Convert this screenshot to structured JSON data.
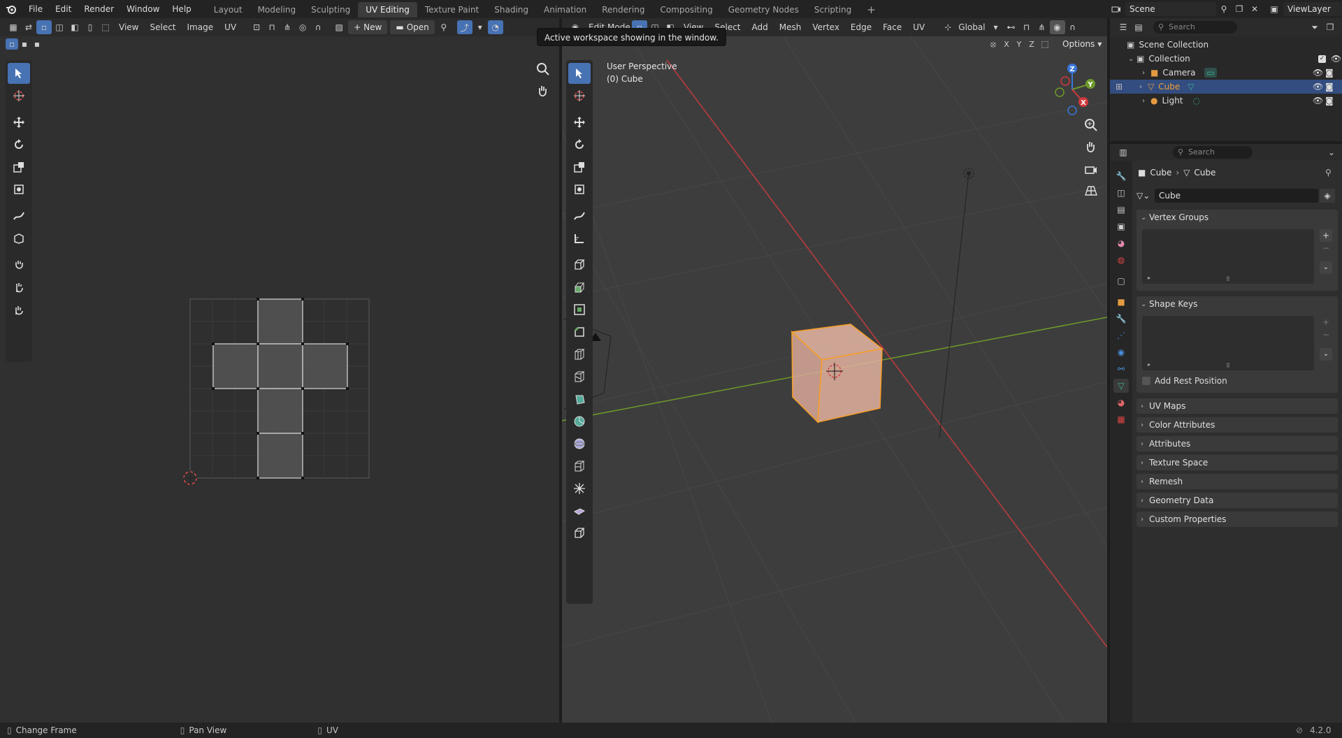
{
  "topbar": {
    "menus": [
      "File",
      "Edit",
      "Render",
      "Window",
      "Help"
    ],
    "workspaces": [
      "Layout",
      "Modeling",
      "Sculpting",
      "UV Editing",
      "Texture Paint",
      "Shading",
      "Animation",
      "Rendering",
      "Compositing",
      "Geometry Nodes",
      "Scripting"
    ],
    "active_workspace": "UV Editing",
    "add_tab": "+",
    "scene": "Scene",
    "view_layer": "ViewLayer"
  },
  "tooltip": "Active workspace showing in the window.",
  "uv_editor": {
    "menus": [
      "View",
      "Select",
      "Image",
      "UV"
    ],
    "new_label": "New",
    "open_label": "Open"
  },
  "viewport": {
    "mode": "Edit Mode",
    "menus": [
      "View",
      "Select",
      "Add",
      "Mesh",
      "Vertex",
      "Edge",
      "Face",
      "UV"
    ],
    "orientation": "Global",
    "options_label": "Options",
    "axis_x": "X",
    "axis_y": "Y",
    "axis_z": "Z",
    "info_line1": "User Perspective",
    "info_line2": "(0) Cube"
  },
  "outliner": {
    "search_placeholder": "Search",
    "scene_collection": "Scene Collection",
    "collection": "Collection",
    "items": [
      {
        "name": "Camera"
      },
      {
        "name": "Cube"
      },
      {
        "name": "Light"
      }
    ]
  },
  "properties": {
    "search_placeholder": "Search",
    "breadcrumb_object": "Cube",
    "breadcrumb_data": "Cube",
    "mesh_name": "Cube",
    "vertex_groups": "Vertex Groups",
    "shape_keys": "Shape Keys",
    "add_rest_position": "Add Rest Position",
    "panels": [
      "UV Maps",
      "Color Attributes",
      "Attributes",
      "Texture Space",
      "Remesh",
      "Geometry Data",
      "Custom Properties"
    ]
  },
  "statusbar": {
    "left": "Change Frame",
    "middle": "Pan View",
    "right": "UV",
    "version": "4.2.0"
  },
  "colors": {
    "accent": "#4772b3",
    "selection_orange": "#f59d2a",
    "x_axis": "#d0393d",
    "y_axis": "#6e9a2a",
    "z_axis": "#3a76d8"
  }
}
